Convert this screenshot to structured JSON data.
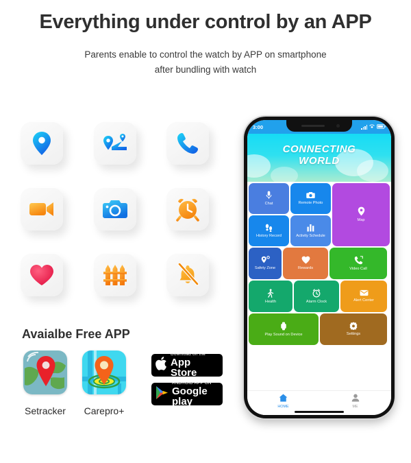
{
  "header": {
    "headline": "Everything under control by an APP",
    "subtitle_line1": "Parents enable to control the watch by APP on smartphone",
    "subtitle_line2": "after bundling with watch"
  },
  "features": [
    {
      "name": "location-pin",
      "label": "Location",
      "color": "#12c8f5",
      "color2": "#1464e8"
    },
    {
      "name": "route-map",
      "label": "Route History",
      "color": "#12c8f5",
      "color2": "#1464e8"
    },
    {
      "name": "phone-call",
      "label": "Phone Call",
      "color": "#12c8f5",
      "color2": "#1464e8"
    },
    {
      "name": "video-camera",
      "label": "Video Call",
      "color": "#ffc048",
      "color2": "#f68a12"
    },
    {
      "name": "photo-camera",
      "label": "Remote Photo",
      "color": "#2fc6f5",
      "color2": "#1270e0"
    },
    {
      "name": "alarm-clock",
      "label": "Alarm Clock",
      "color": "#ffb03a",
      "color2": "#f5860f"
    },
    {
      "name": "heart-health",
      "label": "Health",
      "color": "#ff4d6d",
      "color2": "#e01346"
    },
    {
      "name": "fence-geofence",
      "label": "Safety Zone",
      "color": "#ffc34a",
      "color2": "#f4790d"
    },
    {
      "name": "bell-muted",
      "label": "Silent Mode",
      "color": "#ffc24a",
      "color2": "#f7a01a"
    }
  ],
  "available": {
    "title": "Avaialbe Free APP",
    "apps": [
      {
        "name": "setracker",
        "label": "Setracker"
      },
      {
        "name": "carepro",
        "label": "Carepro+"
      }
    ],
    "badges": [
      {
        "name": "app-store-badge",
        "small": "Download on the",
        "big": "App Store",
        "icon": "apple-icon"
      },
      {
        "name": "google-play-badge",
        "small": "ANDROID APP ON",
        "big": "Google play",
        "icon": "play-triangle-icon"
      }
    ]
  },
  "phone": {
    "status": {
      "time": "3:00",
      "signal": "signal-bars-icon",
      "wifi": "wifi-icon",
      "battery": "battery-icon"
    },
    "banner": {
      "line1": "CONNECTING",
      "line2": "WORLD"
    },
    "tiles": [
      {
        "name": "chat",
        "label": "Chat",
        "icon": "microphone-icon",
        "color": "#4a7ee0"
      },
      {
        "name": "remote-photo",
        "label": "Remote Photo",
        "icon": "camera-icon",
        "color": "#1787ec"
      },
      {
        "name": "map",
        "label": "Map",
        "icon": "map-pin-icon",
        "color": "#b24ae0"
      },
      {
        "name": "history-record",
        "label": "History Record",
        "icon": "footsteps-icon",
        "color": "#1787ec"
      },
      {
        "name": "activity-schedule",
        "label": "Activity Schedule",
        "icon": "chart-bars-icon",
        "color": "#4a8ae8"
      },
      {
        "name": "safety-zone",
        "label": "Safety Zone",
        "icon": "zone-pin-icon",
        "color": "#2c61c4"
      },
      {
        "name": "rewards",
        "label": "Rewards",
        "icon": "heart-icon",
        "color": "#e2793f"
      },
      {
        "name": "video-call",
        "label": "Video Call",
        "icon": "phone-icon",
        "color": "#34b82a"
      },
      {
        "name": "health",
        "label": "Health",
        "icon": "walking-icon",
        "color": "#14a86c"
      },
      {
        "name": "alarm-clock",
        "label": "Alarm Clock",
        "icon": "alarm-icon",
        "color": "#14a86c"
      },
      {
        "name": "alert-center",
        "label": "Alert Center",
        "icon": "envelope-icon",
        "color": "#ef9c1a"
      },
      {
        "name": "play-sound-on-device",
        "label": "Play Sound on Device",
        "icon": "watch-icon",
        "color": "#4aac16"
      },
      {
        "name": "settings",
        "label": "Settings",
        "icon": "gear-icon",
        "color": "#a06a20"
      }
    ],
    "tabs": [
      {
        "name": "home",
        "label": "HOME",
        "icon": "home-icon",
        "active": true,
        "color": "#2b8fe8"
      },
      {
        "name": "me",
        "label": "ME",
        "icon": "person-icon",
        "active": false,
        "color": "#9a9a9a"
      }
    ]
  }
}
